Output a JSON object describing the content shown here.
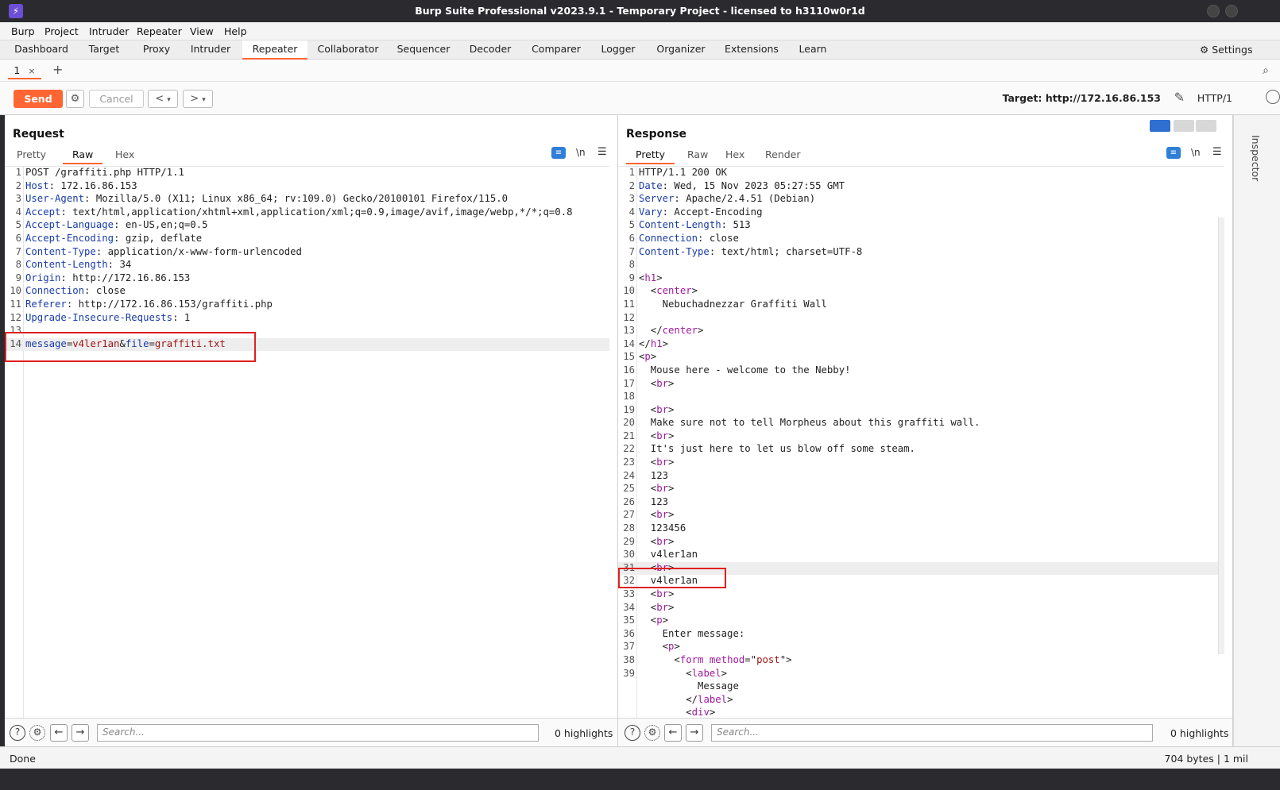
{
  "window": {
    "title": "Burp Suite Professional v2023.9.1 - Temporary Project - licensed to h3110w0r1d",
    "app_icon": "lightning-icon"
  },
  "menu": [
    "Burp",
    "Project",
    "Intruder",
    "Repeater",
    "View",
    "Help"
  ],
  "tabs": [
    "Dashboard",
    "Target",
    "Proxy",
    "Intruder",
    "Repeater",
    "Collaborator",
    "Sequencer",
    "Decoder",
    "Comparer",
    "Logger",
    "Organizer",
    "Extensions",
    "Learn"
  ],
  "active_tab": "Repeater",
  "settings_label": "Settings",
  "subtab": {
    "label": "1",
    "close": "×",
    "add": "+"
  },
  "toolbar": {
    "send": "Send",
    "cancel": "Cancel",
    "back": "<",
    "forward": ">",
    "dropdown": "▾",
    "target": "Target: http://172.16.86.153",
    "http_version": "HTTP/1"
  },
  "request": {
    "title": "Request",
    "views": [
      "Pretty",
      "Raw",
      "Hex"
    ],
    "active_view": "Raw",
    "newline_toggle": "\\n",
    "lines": [
      {
        "n": "1",
        "parts": [
          [
            "",
            "POST /graffiti.php HTTP/1.1"
          ]
        ]
      },
      {
        "n": "2",
        "parts": [
          [
            "k",
            "Host"
          ],
          [
            "",
            ": 172.16.86.153"
          ]
        ]
      },
      {
        "n": "3",
        "parts": [
          [
            "k",
            "User-Agent"
          ],
          [
            "",
            ": Mozilla/5.0 (X11; Linux x86_64; rv:109.0) Gecko/20100101 Firefox/115.0"
          ]
        ]
      },
      {
        "n": "4",
        "parts": [
          [
            "k",
            "Accept"
          ],
          [
            "",
            ": text/html,application/xhtml+xml,application/xml;q=0.9,image/avif,image/webp,*/*;q=0.8"
          ]
        ]
      },
      {
        "n": "5",
        "parts": [
          [
            "k",
            "Accept-Language"
          ],
          [
            "",
            ": en-US,en;q=0.5"
          ]
        ]
      },
      {
        "n": "6",
        "parts": [
          [
            "k",
            "Accept-Encoding"
          ],
          [
            "",
            ": gzip, deflate"
          ]
        ]
      },
      {
        "n": "7",
        "parts": [
          [
            "k",
            "Content-Type"
          ],
          [
            "",
            ": application/x-www-form-urlencoded"
          ]
        ]
      },
      {
        "n": "8",
        "parts": [
          [
            "k",
            "Content-Length"
          ],
          [
            "",
            ": 34"
          ]
        ]
      },
      {
        "n": "9",
        "parts": [
          [
            "k",
            "Origin"
          ],
          [
            "",
            ": http://172.16.86.153"
          ]
        ]
      },
      {
        "n": "10",
        "parts": [
          [
            "k",
            "Connection"
          ],
          [
            "",
            ": close"
          ]
        ]
      },
      {
        "n": "11",
        "parts": [
          [
            "k",
            "Referer"
          ],
          [
            "",
            ": http://172.16.86.153/graffiti.php"
          ]
        ]
      },
      {
        "n": "12",
        "parts": [
          [
            "k",
            "Upgrade-Insecure-Requests"
          ],
          [
            "",
            ": 1"
          ]
        ]
      },
      {
        "n": "13",
        "parts": [
          [
            "",
            ""
          ]
        ]
      },
      {
        "n": "14",
        "parts": [
          [
            "k",
            "message"
          ],
          [
            "",
            "="
          ],
          [
            "v",
            "v4ler1an"
          ],
          [
            "",
            "&"
          ],
          [
            "k",
            "file"
          ],
          [
            "",
            "="
          ],
          [
            "v",
            "graffiti.txt"
          ]
        ],
        "highlight": true
      }
    ],
    "search_placeholder": "Search...",
    "highlights": "0 highlights"
  },
  "response": {
    "title": "Response",
    "views": [
      "Pretty",
      "Raw",
      "Hex",
      "Render"
    ],
    "active_view": "Pretty",
    "newline_toggle": "\\n",
    "lines": [
      {
        "n": "1",
        "parts": [
          [
            "",
            "HTTP/1.1 200 OK"
          ]
        ]
      },
      {
        "n": "2",
        "parts": [
          [
            "k",
            "Date"
          ],
          [
            "",
            ": Wed, 15 Nov 2023 05:27:55 GMT"
          ]
        ]
      },
      {
        "n": "3",
        "parts": [
          [
            "k",
            "Server"
          ],
          [
            "",
            ": Apache/2.4.51 (Debian)"
          ]
        ]
      },
      {
        "n": "4",
        "parts": [
          [
            "k",
            "Vary"
          ],
          [
            "",
            ": Accept-Encoding"
          ]
        ]
      },
      {
        "n": "5",
        "parts": [
          [
            "k",
            "Content-Length"
          ],
          [
            "",
            ": 513"
          ]
        ]
      },
      {
        "n": "6",
        "parts": [
          [
            "k",
            "Connection"
          ],
          [
            "",
            ": close"
          ]
        ]
      },
      {
        "n": "7",
        "parts": [
          [
            "k",
            "Content-Type"
          ],
          [
            "",
            ": text/html; charset=UTF-8"
          ]
        ]
      },
      {
        "n": "8",
        "parts": [
          [
            "",
            ""
          ]
        ]
      },
      {
        "n": "9",
        "parts": [
          [
            "",
            "<"
          ],
          [
            "t",
            "h1"
          ],
          [
            "",
            ">"
          ]
        ]
      },
      {
        "n": "10",
        "parts": [
          [
            "",
            "  <"
          ],
          [
            "t",
            "center"
          ],
          [
            "",
            ">"
          ]
        ]
      },
      {
        "n": "11",
        "parts": [
          [
            "",
            "    Nebuchadnezzar Graffiti Wall"
          ]
        ]
      },
      {
        "n": "12",
        "parts": [
          [
            "",
            ""
          ]
        ]
      },
      {
        "n": "13",
        "parts": [
          [
            "",
            "  </"
          ],
          [
            "t",
            "center"
          ],
          [
            "",
            ">"
          ]
        ]
      },
      {
        "n": "14",
        "parts": [
          [
            "",
            "</"
          ],
          [
            "t",
            "h1"
          ],
          [
            "",
            ">"
          ]
        ]
      },
      {
        "n": "15",
        "parts": [
          [
            "",
            "<"
          ],
          [
            "t",
            "p"
          ],
          [
            "",
            ">"
          ]
        ]
      },
      {
        "n": "16",
        "parts": [
          [
            "",
            "  Mouse here - welcome to the Nebby!"
          ]
        ]
      },
      {
        "n": "17",
        "parts": [
          [
            "",
            "  <"
          ],
          [
            "t",
            "br"
          ],
          [
            "",
            ">"
          ]
        ]
      },
      {
        "n": "18",
        "parts": [
          [
            "",
            ""
          ]
        ]
      },
      {
        "n": "19",
        "parts": [
          [
            "",
            "  <"
          ],
          [
            "t",
            "br"
          ],
          [
            "",
            ">"
          ]
        ]
      },
      {
        "n": "20",
        "parts": [
          [
            "",
            "  Make sure not to tell Morpheus about this graffiti wall."
          ]
        ]
      },
      {
        "n": "21",
        "parts": [
          [
            "",
            "  <"
          ],
          [
            "t",
            "br"
          ],
          [
            "",
            ">"
          ]
        ]
      },
      {
        "n": "22",
        "parts": [
          [
            "",
            "  It's just here to let us blow off some steam."
          ]
        ]
      },
      {
        "n": "23",
        "parts": [
          [
            "",
            "  <"
          ],
          [
            "t",
            "br"
          ],
          [
            "",
            ">"
          ]
        ]
      },
      {
        "n": "24",
        "parts": [
          [
            "",
            "  123"
          ]
        ]
      },
      {
        "n": "25",
        "parts": [
          [
            "",
            "  <"
          ],
          [
            "t",
            "br"
          ],
          [
            "",
            ">"
          ]
        ]
      },
      {
        "n": "26",
        "parts": [
          [
            "",
            "  123"
          ]
        ]
      },
      {
        "n": "27",
        "parts": [
          [
            "",
            "  <"
          ],
          [
            "t",
            "br"
          ],
          [
            "",
            ">"
          ]
        ]
      },
      {
        "n": "28",
        "parts": [
          [
            "",
            "  123456"
          ]
        ]
      },
      {
        "n": "29",
        "parts": [
          [
            "",
            "  <"
          ],
          [
            "t",
            "br"
          ],
          [
            "",
            ">"
          ]
        ]
      },
      {
        "n": "30",
        "parts": [
          [
            "",
            "  v4ler1an"
          ]
        ]
      },
      {
        "n": "31",
        "parts": [
          [
            "",
            "  <"
          ],
          [
            "t",
            "br"
          ],
          [
            "",
            ">"
          ]
        ],
        "highlight": true
      },
      {
        "n": "32",
        "parts": [
          [
            "",
            "  v4ler1an"
          ]
        ]
      },
      {
        "n": "33",
        "parts": [
          [
            "",
            "  <"
          ],
          [
            "t",
            "br"
          ],
          [
            "",
            ">"
          ]
        ]
      },
      {
        "n": "34",
        "parts": [
          [
            "",
            "  <"
          ],
          [
            "t",
            "br"
          ],
          [
            "",
            ">"
          ]
        ]
      },
      {
        "n": "35",
        "parts": [
          [
            "",
            "  <"
          ],
          [
            "t",
            "p"
          ],
          [
            "",
            ">"
          ]
        ]
      },
      {
        "n": "36",
        "parts": [
          [
            "",
            "    Enter message:"
          ]
        ]
      },
      {
        "n": "37",
        "parts": [
          [
            "",
            "    <"
          ],
          [
            "t",
            "p"
          ],
          [
            "",
            ">"
          ]
        ]
      },
      {
        "n": "38",
        "parts": [
          [
            "",
            "      <"
          ],
          [
            "t",
            "form"
          ],
          [
            "",
            " "
          ],
          [
            "t",
            "method"
          ],
          [
            "",
            "=\""
          ],
          [
            "v",
            "post"
          ],
          [
            "",
            "\">"
          ]
        ]
      },
      {
        "n": "39",
        "parts": [
          [
            "",
            "        <"
          ],
          [
            "t",
            "label"
          ],
          [
            "",
            ">"
          ]
        ]
      },
      {
        "n": "",
        "parts": [
          [
            "",
            "          Message"
          ]
        ]
      },
      {
        "n": "",
        "parts": [
          [
            "",
            "        </"
          ],
          [
            "t",
            "label"
          ],
          [
            "",
            ">"
          ]
        ]
      },
      {
        "n": "",
        "parts": [
          [
            "",
            "        <"
          ],
          [
            "t",
            "div"
          ],
          [
            "",
            ">"
          ]
        ]
      }
    ],
    "search_placeholder": "Search...",
    "highlights": "0 highlights"
  },
  "inspector_label": "Inspector",
  "status": {
    "left": "Done",
    "right": "704 bytes | 1 mil"
  }
}
